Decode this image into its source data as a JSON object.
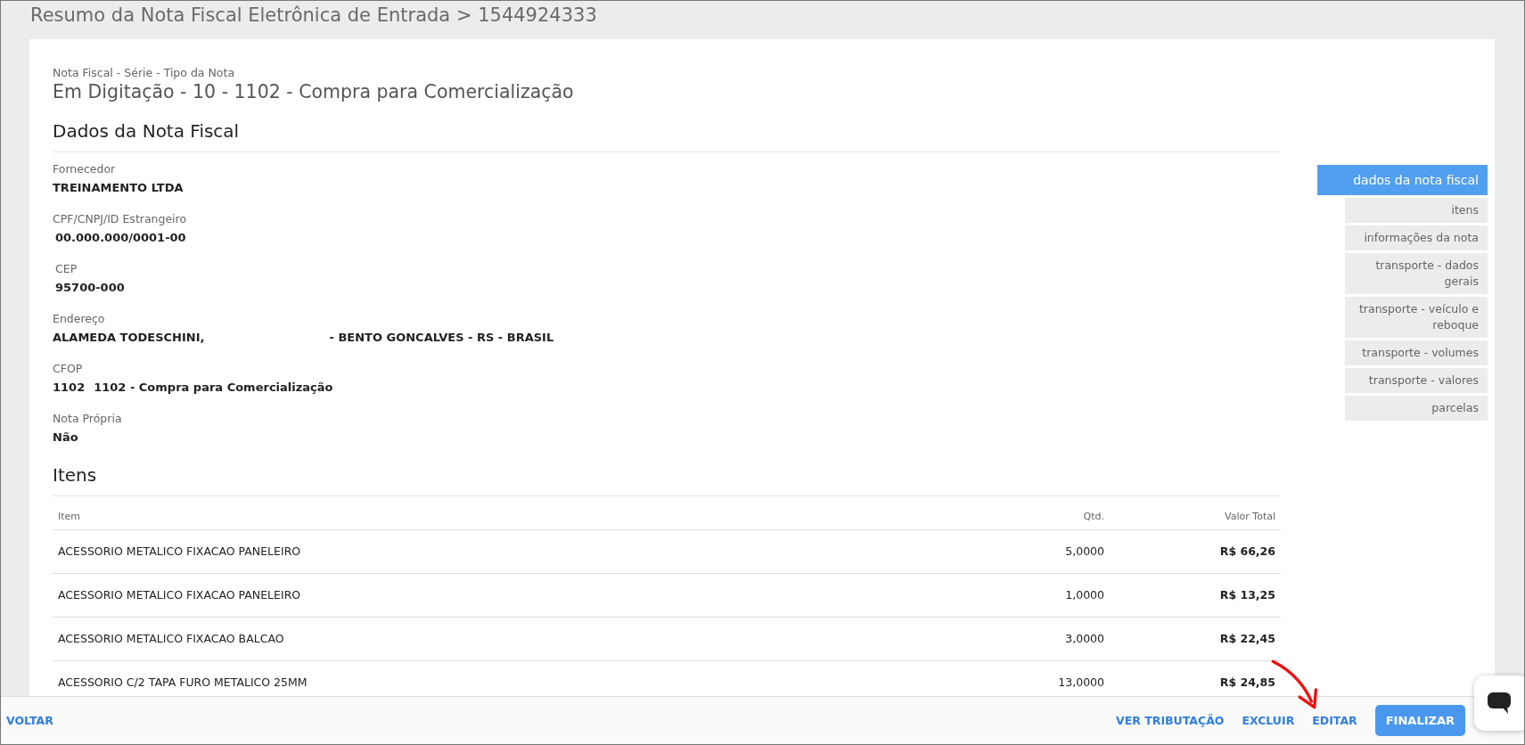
{
  "page_title": "Resumo da Nota Fiscal Eletrônica de Entrada > 1544924333",
  "note": {
    "caption": "Nota Fiscal - Série - Tipo da Nota",
    "headline": "Em Digitação - 10 - 1102 - Compra para Comercialização"
  },
  "sections": [
    {
      "title": "Dados da Nota Fiscal",
      "fields": [
        {
          "label": "Fornecedor",
          "value": "TREINAMENTO LTDA"
        },
        {
          "label": "CPF/CNPJ/ID Estrangeiro",
          "value": "00.000.000/0001-00"
        },
        {
          "label": "CEP",
          "value": "95700-000"
        },
        {
          "label": "Endereço",
          "value": "ALAMEDA TODESCHINI,",
          "value_2": "- BENTO GONCALVES - RS - BRASIL"
        },
        {
          "label": "CFOP",
          "value": "1102",
          "value_2": "1102 - Compra para Comercialização"
        },
        {
          "label": "Nota Própria",
          "value": "Não"
        }
      ]
    },
    {
      "title": "Itens",
      "table": {
        "columns": [
          "Item",
          "Qtd.",
          "Valor Total"
        ],
        "rows": [
          [
            "ACESSORIO METALICO FIXACAO PANELEIRO",
            "5,0000",
            "R$ 66,26"
          ],
          [
            "ACESSORIO METALICO FIXACAO PANELEIRO",
            "1,0000",
            "R$ 13,25"
          ],
          [
            "ACESSORIO METALICO FIXACAO BALCAO",
            "3,0000",
            "R$ 22,45"
          ],
          [
            "ACESSORIO C/2 TAPA FURO METALICO 25MM",
            "13,0000",
            "R$ 24,85"
          ]
        ]
      }
    }
  ],
  "side_nav": [
    {
      "label": "dados da nota fiscal",
      "selected": true
    },
    {
      "label": "itens",
      "selected": false
    },
    {
      "label": "informações da nota",
      "selected": false
    },
    {
      "label": "transporte - dados gerais",
      "selected": false
    },
    {
      "label": "transporte - veículo e reboque",
      "selected": false
    },
    {
      "label": "transporte - volumes",
      "selected": false
    },
    {
      "label": "transporte - valores",
      "selected": false
    },
    {
      "label": "parcelas",
      "selected": false
    }
  ],
  "footer": {
    "back": "VOLTAR",
    "actions": [
      {
        "label": "VER TRIBUTAÇÃO",
        "kind": "link"
      },
      {
        "label": "EXCLUIR",
        "kind": "link"
      },
      {
        "label": "EDITAR",
        "kind": "link"
      },
      {
        "label": "FINALIZAR",
        "kind": "primary"
      }
    ]
  }
}
